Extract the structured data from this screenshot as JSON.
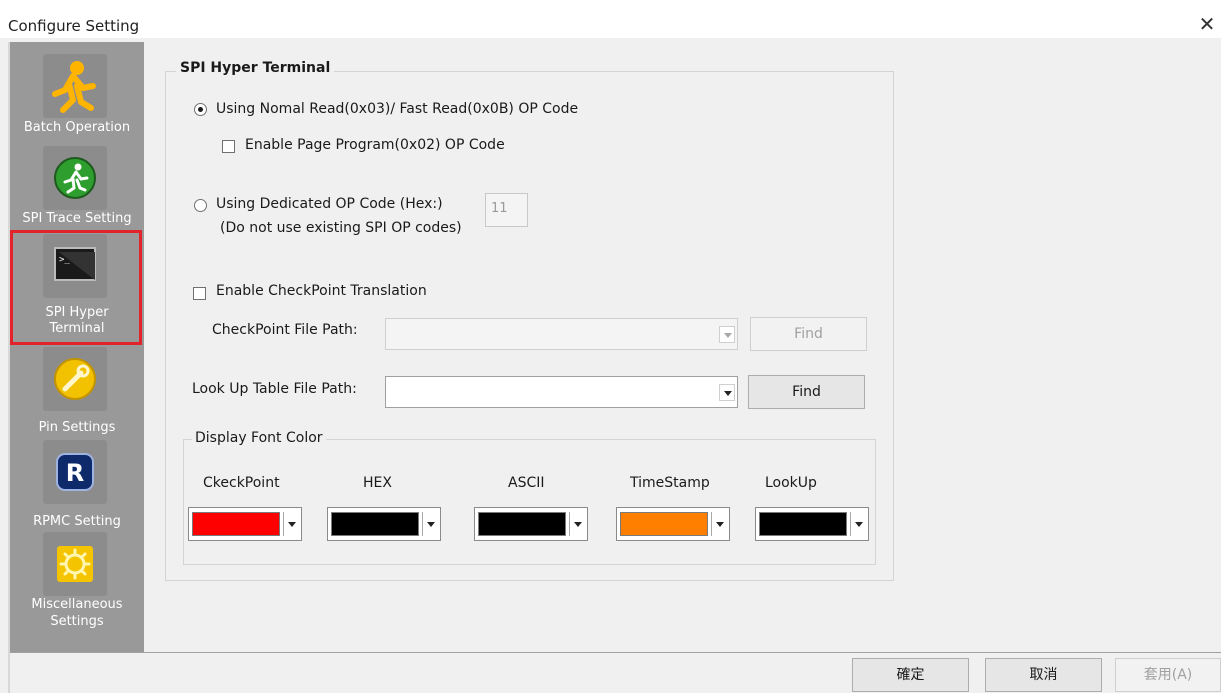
{
  "window": {
    "title": "Configure Setting",
    "close_icon": "close-icon"
  },
  "sidebar": {
    "items": [
      {
        "id": "batch",
        "label": "Batch Operation",
        "icon": "running-person-icon"
      },
      {
        "id": "trace",
        "label": "SPI Trace Setting",
        "icon": "green-runner-icon"
      },
      {
        "id": "terminal",
        "label": "SPI Hyper Terminal",
        "icon": "terminal-icon",
        "selected": true
      },
      {
        "id": "pin",
        "label": "Pin Settings",
        "icon": "wrench-icon"
      },
      {
        "id": "rpmc",
        "label": "RPMC Setting",
        "icon": "r-badge-icon"
      },
      {
        "id": "misc",
        "label": "Miscellaneous Settings",
        "icon": "gear-icon"
      }
    ],
    "labels": {
      "batch": "Batch Operation",
      "trace": "SPI Trace Setting",
      "terminal_line1": "SPI Hyper",
      "terminal_line2": "Terminal",
      "pin": "Pin Settings",
      "rpmc": "RPMC Setting",
      "misc_line1": "Miscellaneous",
      "misc_line2": "Settings"
    }
  },
  "panel": {
    "title": "SPI Hyper Terminal",
    "radio_normal": "Using Nomal Read(0x03)/ Fast Read(0x0B) OP Code",
    "radio_normal_checked": true,
    "check_page_program": "Enable Page Program(0x02) OP Code",
    "check_page_program_checked": false,
    "radio_dedicated": "Using Dedicated OP Code (Hex:)",
    "radio_dedicated_note": "(Do not use existing SPI OP codes)",
    "radio_dedicated_checked": false,
    "opcode_value": "11",
    "check_checkpoint": "Enable CheckPoint Translation",
    "check_checkpoint_checked": false,
    "checkpoint_path_label": "CheckPoint File Path:",
    "checkpoint_path_value": "",
    "checkpoint_find": "Find",
    "lookup_path_label": "Look Up Table File Path:",
    "lookup_path_value": "",
    "lookup_find": "Find"
  },
  "font_colors": {
    "title": "Display Font Color",
    "items": [
      {
        "label": "CkeckPoint",
        "color": "#ff0000"
      },
      {
        "label": "HEX",
        "color": "#000000"
      },
      {
        "label": "ASCII",
        "color": "#000000"
      },
      {
        "label": "TimeStamp",
        "color": "#ff8000"
      },
      {
        "label": "LookUp",
        "color": "#000000"
      }
    ]
  },
  "buttons": {
    "ok": "確定",
    "cancel": "取消",
    "apply": "套用(A)"
  }
}
